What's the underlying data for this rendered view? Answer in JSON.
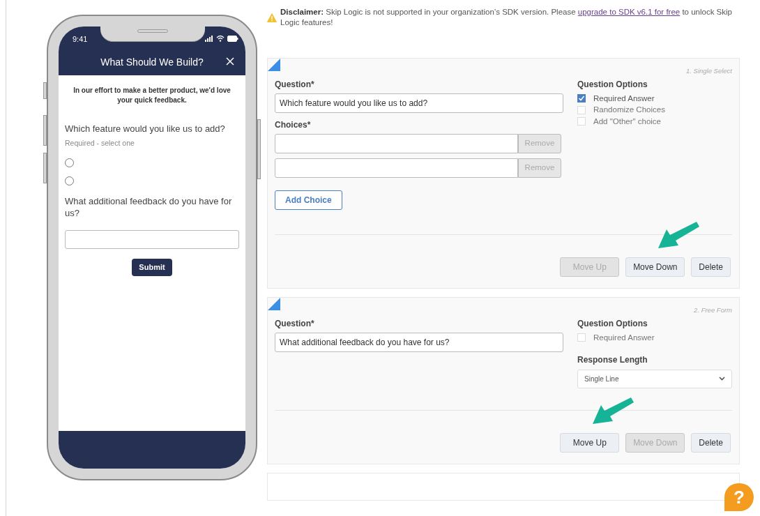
{
  "phone": {
    "time": "9:41",
    "title": "What Should We Build?",
    "intro": "In our effort to make a better product, we'd love your quick feedback.",
    "questions": [
      {
        "kind": "radio",
        "text": "Which feature would you like us to add?",
        "hint": "Required - select one",
        "options": [
          {
            "selected": false
          },
          {
            "selected": false
          }
        ]
      },
      {
        "kind": "text",
        "text": "What additional feedback do you have for us?"
      }
    ],
    "submit": "Submit"
  },
  "disclaimer": {
    "before": "**Disclaimer:** Skip Logic is not supported in your organization’s SDK version. Please ",
    "link": "upgrade to SDK v6.1 for free",
    "after": " to unlock Skip Logic features!"
  },
  "cards": [
    {
      "kind": "single_select",
      "type_label": "1. Single Select",
      "question_label": "Question*",
      "question_value": "Which feature would you like us to add?",
      "choices_label": "Choices*",
      "choices": [
        {
          "remove": "Remove",
          "disabled": true
        },
        {
          "remove": "Remove",
          "disabled": true
        }
      ],
      "add_choice": "Add Choice",
      "options_title": "Question Options",
      "options": [
        {
          "label": "Required Answer",
          "checked": true
        },
        {
          "label": "Randomize Choices",
          "checked": false
        },
        {
          "label": "Add \"Other\" choice",
          "checked": false
        }
      ],
      "buttons": [
        {
          "label": "Move Up",
          "disabled": true,
          "highlighted": false
        },
        {
          "label": "Move Down",
          "disabled": false,
          "highlighted": true
        },
        {
          "label": "Delete",
          "disabled": false,
          "highlighted": false
        }
      ]
    },
    {
      "kind": "free_form",
      "type_label": "2. Free Form",
      "question_label": "Question*",
      "question_value": "What additional feedback do you have for us?",
      "options_title": "Question Options",
      "options": [
        {
          "label": "Required Answer",
          "checked": false
        }
      ],
      "length_label": "Response Length",
      "length_value": "Single Line",
      "buttons": [
        {
          "label": "Move Up",
          "disabled": false,
          "highlighted": true
        },
        {
          "label": "Move Down",
          "disabled": true,
          "highlighted": false
        },
        {
          "label": "Delete",
          "disabled": false,
          "highlighted": false
        }
      ]
    }
  ],
  "help": "?"
}
